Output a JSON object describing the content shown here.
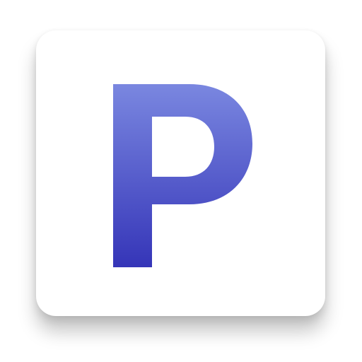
{
  "app_icon": {
    "letter": "P",
    "colors": {
      "tile_background": "#ffffff",
      "letter_gradient_top": "#7a87e0",
      "letter_gradient_bottom": "#3535b8"
    }
  }
}
